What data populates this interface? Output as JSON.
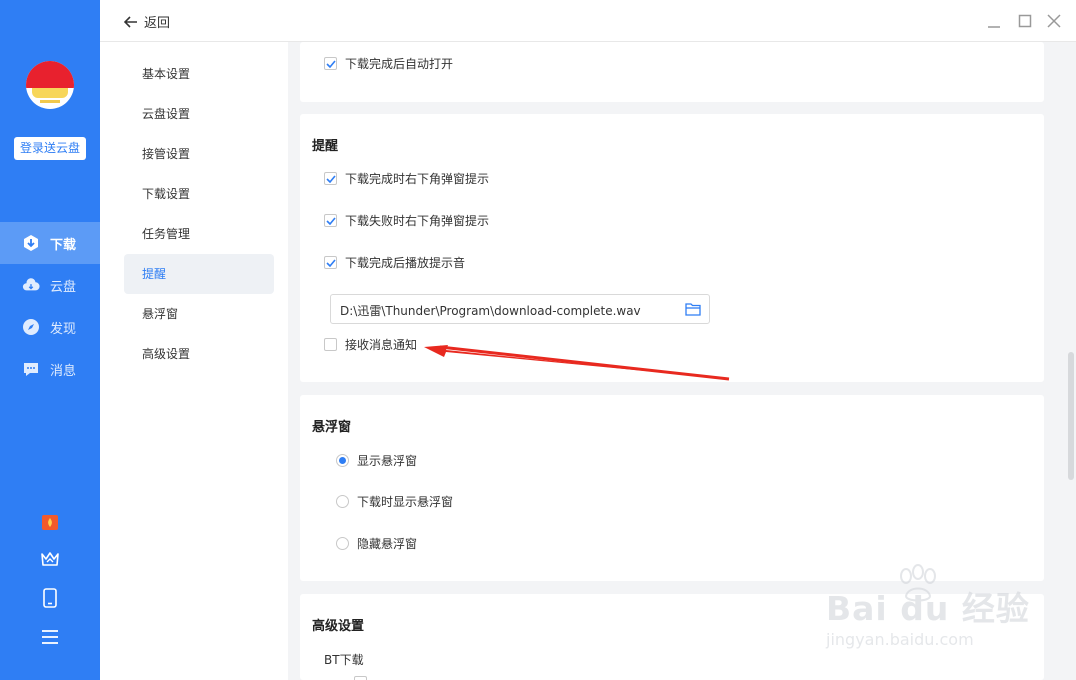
{
  "nav": {
    "login_label": "登录送云盘",
    "items": [
      {
        "label": "下载",
        "icon": "download-shield-icon"
      },
      {
        "label": "云盘",
        "icon": "cloud-icon"
      },
      {
        "label": "发现",
        "icon": "compass-icon"
      },
      {
        "label": "消息",
        "icon": "message-icon"
      }
    ],
    "active": "下载"
  },
  "titlebar": {
    "back_label": "返回"
  },
  "sidebar": {
    "items": [
      {
        "label": "基本设置"
      },
      {
        "label": "云盘设置"
      },
      {
        "label": "接管设置"
      },
      {
        "label": "下载设置"
      },
      {
        "label": "任务管理"
      },
      {
        "label": "提醒"
      },
      {
        "label": "悬浮窗"
      },
      {
        "label": "高级设置"
      }
    ],
    "active": "提醒"
  },
  "content": {
    "top_card": {
      "option": {
        "label": "下载完成后自动打开",
        "checked": true
      }
    },
    "remind_card": {
      "title": "提醒",
      "options": [
        {
          "label": "下载完成时右下角弹窗提示",
          "checked": true
        },
        {
          "label": "下载失败时右下角弹窗提示",
          "checked": true
        },
        {
          "label": "下载完成后播放提示音",
          "checked": true
        }
      ],
      "sound_path": "D:\\迅雷\\Thunder\\Program\\download-complete.wav",
      "notify": {
        "label": "接收消息通知",
        "checked": false
      }
    },
    "float_card": {
      "title": "悬浮窗",
      "options": [
        {
          "label": "显示悬浮窗",
          "selected": true
        },
        {
          "label": "下载时显示悬浮窗",
          "selected": false
        },
        {
          "label": "隐藏悬浮窗",
          "selected": false
        }
      ]
    },
    "advanced_card": {
      "title": "高级设置",
      "subtitle": "BT下载"
    }
  },
  "watermark": {
    "text": "Bai du 经验",
    "url": "jingyan.baidu.com"
  },
  "colors": {
    "accent": "#2f7ef4",
    "arrow": "#e8291f"
  }
}
